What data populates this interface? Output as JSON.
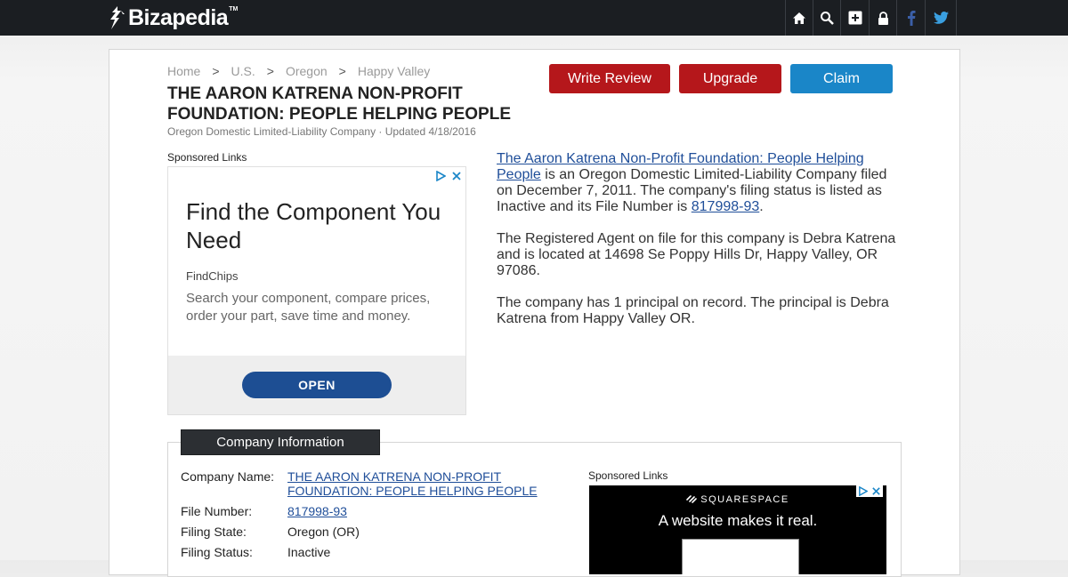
{
  "header": {
    "logo_text": "Bizapedia",
    "logo_tm": "TM",
    "icons": [
      "home-icon",
      "search-icon",
      "add-icon",
      "lock-icon",
      "facebook-icon",
      "twitter-icon"
    ]
  },
  "breadcrumb": [
    "Home",
    "U.S.",
    "Oregon",
    "Happy Valley"
  ],
  "breadcrumb_sep": ">",
  "page": {
    "title": "THE AARON KATRENA NON-PROFIT FOUNDATION: PEOPLE HELPING PEOPLE",
    "subtitle": "Oregon Domestic Limited-Liability Company · Updated 4/18/2016"
  },
  "actions": {
    "write_review": "Write Review",
    "upgrade": "Upgrade",
    "claim": "Claim"
  },
  "colors": {
    "red": "#b5171b",
    "blue": "#1a86c8",
    "dark": "#1b1e22",
    "link": "#1f4e99"
  },
  "sponsored_label": "Sponsored Links",
  "ad1": {
    "headline": "Find the Component You Need",
    "brand": "FindChips",
    "body": "Search your component, compare prices, order your part, save time and money.",
    "cta": "OPEN"
  },
  "description": {
    "company_link": "The Aaron Katrena Non-Profit Foundation: People Helping People",
    "p1_text": " is an Oregon Domestic Limited-Liability Company filed on December 7, 2011. The company's filing status is listed as Inactive and its File Number is ",
    "file_number": "817998-93",
    "p1_end": ".",
    "p2": "The Registered Agent on file for this company is Debra Katrena and is located at 14698 Se Poppy Hills Dr, Happy Valley, OR 97086.",
    "p3": "The company has 1 principal on record. The principal is Debra Katrena from Happy Valley OR."
  },
  "company_info": {
    "tab_label": "Company Information",
    "rows": [
      {
        "label": "Company Name:",
        "value": "THE AARON KATRENA NON-PROFIT FOUNDATION: PEOPLE HELPING PEOPLE",
        "link": true
      },
      {
        "label": "File Number:",
        "value": "817998-93",
        "link": true
      },
      {
        "label": "Filing State:",
        "value": "Oregon (OR)",
        "link": false
      },
      {
        "label": "Filing Status:",
        "value": "Inactive",
        "link": false
      }
    ]
  },
  "ad2": {
    "brand": "SQUARESPACE",
    "headline": "A website makes it real."
  }
}
